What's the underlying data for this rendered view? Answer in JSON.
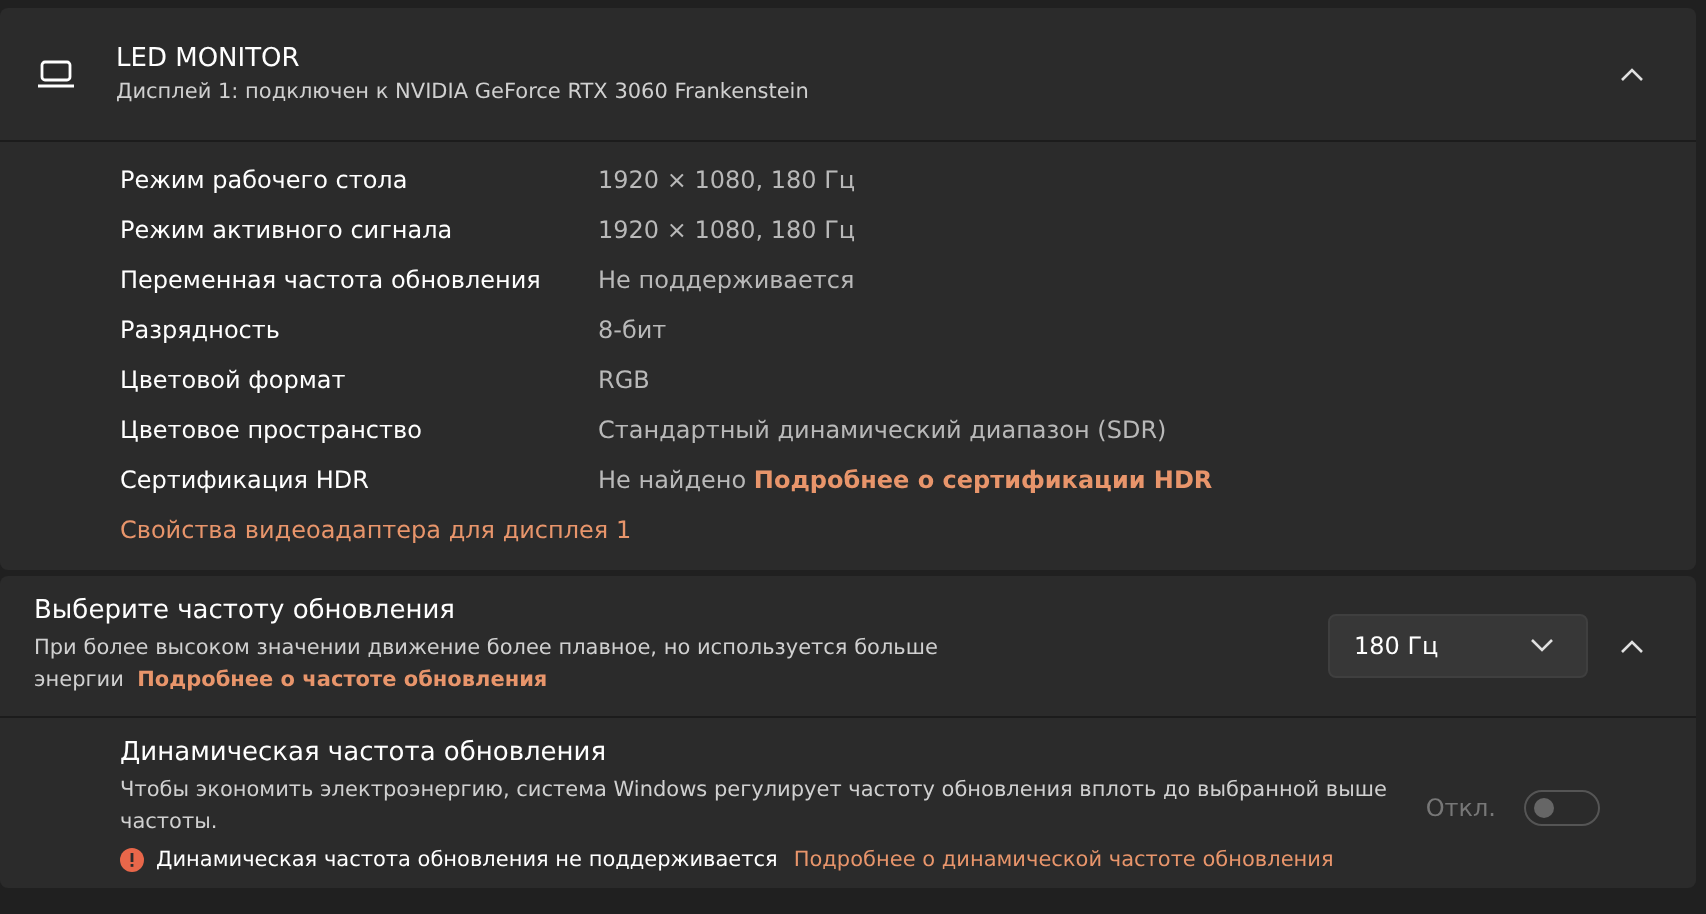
{
  "display": {
    "title": "LED MONITOR",
    "subtitle": "Дисплей 1: подключен к NVIDIA GeForce RTX 3060 Frankenstein",
    "expanded": true,
    "properties": [
      {
        "label": "Режим рабочего стола",
        "value": "1920 × 1080, 180 Гц"
      },
      {
        "label": "Режим активного сигнала",
        "value": "1920 × 1080, 180 Гц"
      },
      {
        "label": "Переменная частота обновления",
        "value": "Не поддерживается"
      },
      {
        "label": "Разрядность",
        "value": "8-бит"
      },
      {
        "label": "Цветовой формат",
        "value": "RGB"
      },
      {
        "label": "Цветовое пространство",
        "value": "Стандартный динамический диапазон (SDR)"
      },
      {
        "label": "Сертификация HDR",
        "value": "Не найдено",
        "link": "Подробнее о сертификации HDR"
      }
    ],
    "adapter_link": "Свойства видеоадаптера для дисплея 1"
  },
  "refresh_rate": {
    "title": "Выберите частоту обновления",
    "description": "При более высоком значении движение более плавное, но используется больше энергии",
    "link": "Подробнее о частоте обновления",
    "selected_rate": "180 Гц",
    "expanded": true
  },
  "dynamic_refresh": {
    "title": "Динамическая частота обновления",
    "description": "Чтобы экономить электроэнергию, система Windows регулирует частоту обновления вплоть до выбранной выше частоты.",
    "warning": "Динамическая частота обновления не поддерживается",
    "warning_link": "Подробнее о динамической частоте обновления",
    "toggle_label": "Откл.",
    "on": false,
    "disabled": true
  }
}
